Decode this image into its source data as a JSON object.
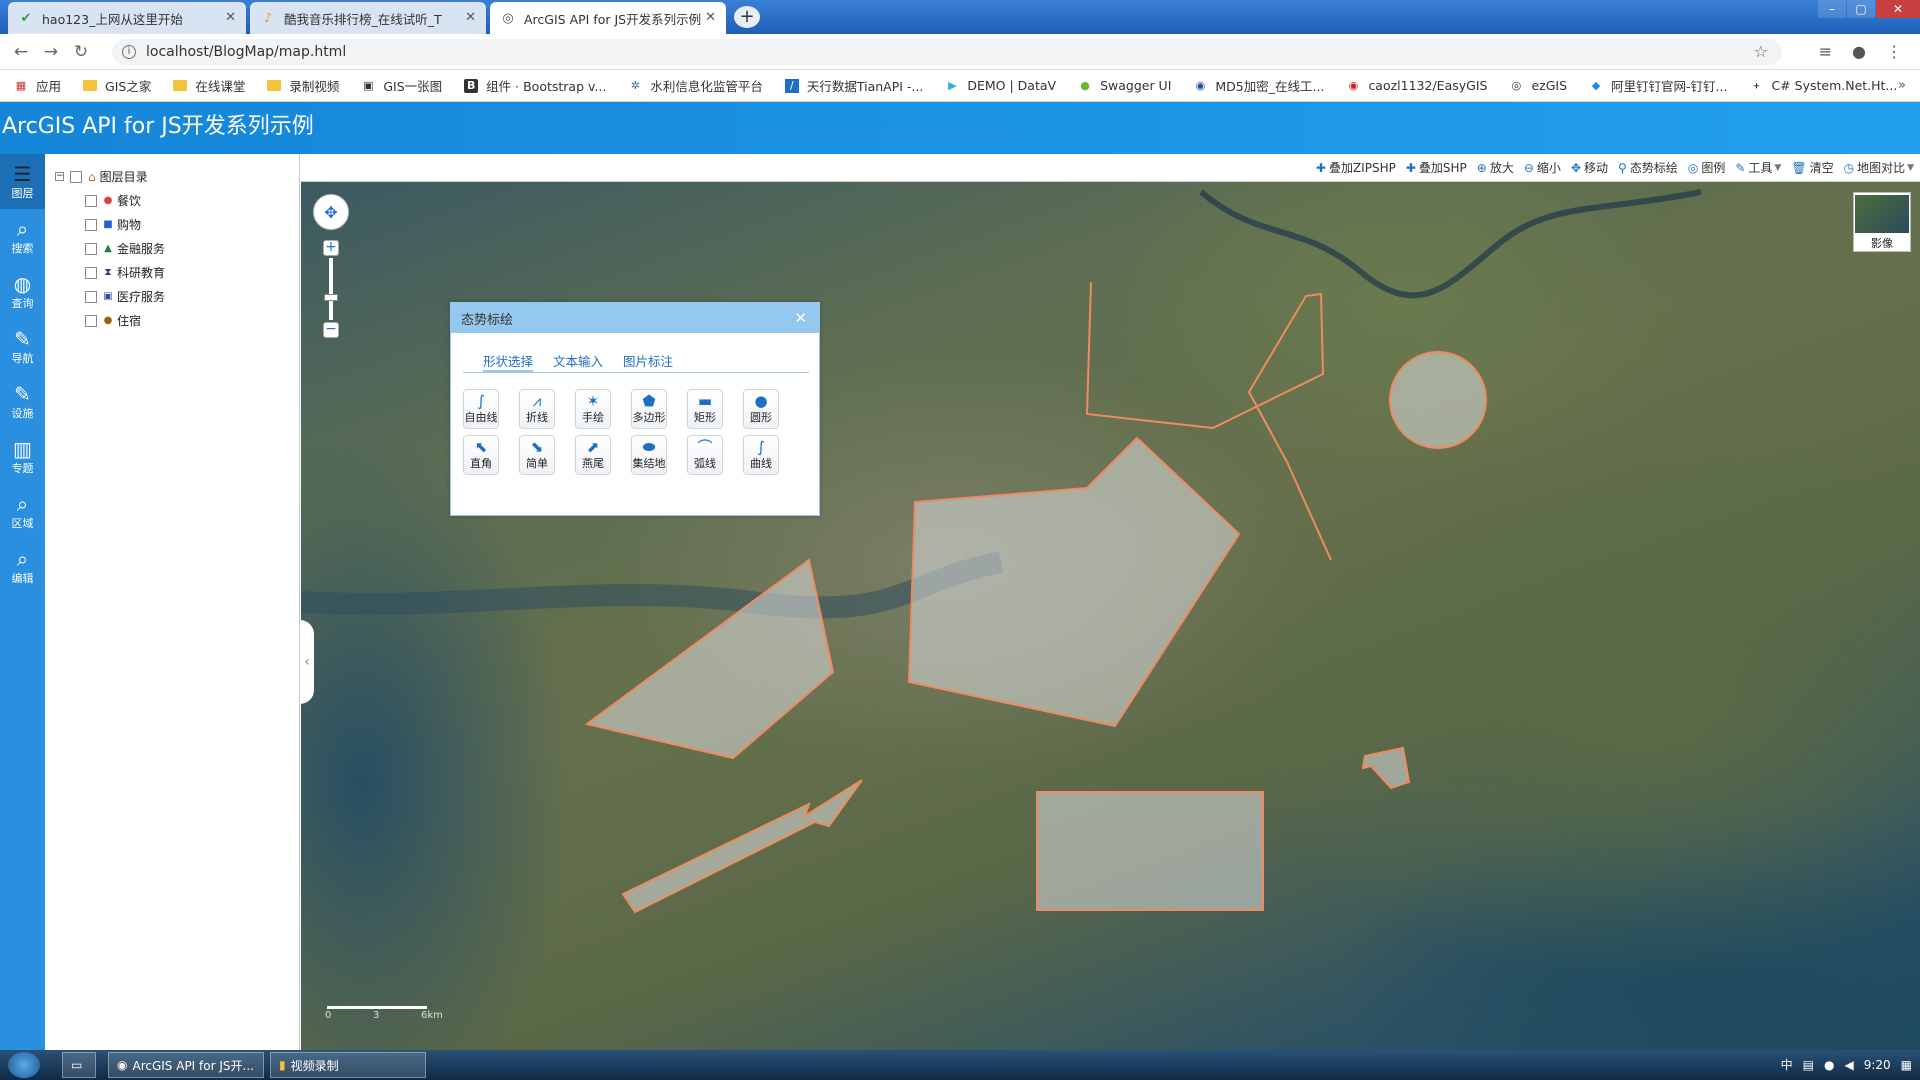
{
  "browser": {
    "tabs": [
      {
        "label": "hao123_上网从这里开始",
        "icon": "hao123-icon"
      },
      {
        "label": "酷我音乐排行榜_在线试听_T",
        "icon": "kuwo-icon"
      },
      {
        "label": "ArcGIS API for JS开发系列示例",
        "icon": "globe-icon"
      }
    ],
    "url": "localhost/BlogMap/map.html",
    "bookmarks": [
      "应用",
      "GIS之家",
      "在线课堂",
      "录制视频",
      "GIS一张图",
      "组件 · Bootstrap v...",
      "水利信息化监管平台",
      "天行数据TianAPI -...",
      "DEMO | DataV",
      "Swagger UI",
      "MD5加密_在线工...",
      "caozl1132/EasyGIS",
      "ezGIS",
      "阿里钉钉官网-钉钉...",
      "C# System.Net.Ht..."
    ]
  },
  "app": {
    "title": "ArcGIS API for JS开发系列示例"
  },
  "leftbar": {
    "items": [
      {
        "label": "图层",
        "icon": "layers-icon"
      },
      {
        "label": "搜索",
        "icon": "search-icon"
      },
      {
        "label": "查询",
        "icon": "globe-query-icon"
      },
      {
        "label": "导航",
        "icon": "navigate-icon"
      },
      {
        "label": "设施",
        "icon": "facility-icon"
      },
      {
        "label": "专题",
        "icon": "thematic-icon"
      },
      {
        "label": "区域",
        "icon": "region-icon"
      },
      {
        "label": "编辑",
        "icon": "edit-icon"
      }
    ]
  },
  "layers": {
    "root": "图层目录",
    "items": [
      {
        "label": "餐饮",
        "color": "#e04040"
      },
      {
        "label": "购物",
        "color": "#2060d0"
      },
      {
        "label": "金融服务",
        "color": "#208040"
      },
      {
        "label": "科研教育",
        "color": "#203080"
      },
      {
        "label": "医疗服务",
        "color": "#3050a0"
      },
      {
        "label": "住宿",
        "color": "#a06010"
      }
    ]
  },
  "toolbar": {
    "items": [
      "叠加ZIPSHP",
      "叠加SHP",
      "放大",
      "缩小",
      "移动",
      "态势标绘",
      "图例",
      "工具",
      "清空",
      "地图对比"
    ]
  },
  "map": {
    "basemap_label": "影像",
    "scale": {
      "l0": "0",
      "l1": "3",
      "l2": "6km"
    }
  },
  "dialog": {
    "title": "态势标绘",
    "tabs": [
      "形状选择",
      "文本输入",
      "图片标注"
    ],
    "shapes": [
      "自由线",
      "折线",
      "手绘",
      "多边形",
      "矩形",
      "圆形",
      "直角",
      "简单",
      "燕尾",
      "集结地",
      "弧线",
      "曲线"
    ]
  },
  "taskbar": {
    "tasks": [
      "ArcGIS API for JS开...",
      "视频录制"
    ],
    "time": "9:20",
    "ime": "中"
  }
}
